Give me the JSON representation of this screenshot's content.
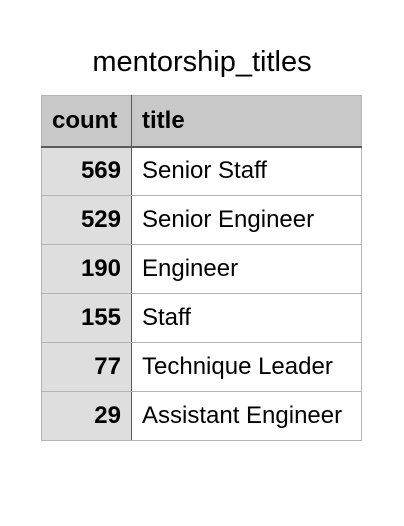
{
  "title": "mentorship_titles",
  "columns": [
    "count",
    "title"
  ],
  "rows": [
    {
      "count": "569",
      "title": "Senior Staff"
    },
    {
      "count": "529",
      "title": "Senior Engineer"
    },
    {
      "count": "190",
      "title": "Engineer"
    },
    {
      "count": "155",
      "title": "Staff"
    },
    {
      "count": "77",
      "title": "Technique Leader"
    },
    {
      "count": "29",
      "title": "Assistant Engineer"
    }
  ]
}
